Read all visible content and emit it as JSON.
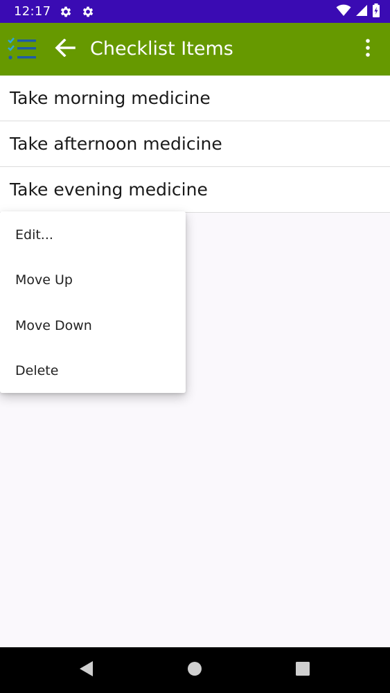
{
  "status_bar": {
    "time": "12:17",
    "icons": [
      "gear-icon",
      "gear-icon",
      "wifi-icon",
      "signal-icon",
      "battery-icon"
    ]
  },
  "app_bar": {
    "title": "Checklist Items",
    "background": "#669900",
    "icons": [
      "checklist-app-icon",
      "back-arrow-icon",
      "overflow-menu-icon"
    ]
  },
  "list": {
    "items": [
      {
        "label": "Take morning medicine"
      },
      {
        "label": "Take afternoon medicine"
      },
      {
        "label": "Take evening medicine"
      }
    ]
  },
  "context_menu": {
    "items": [
      {
        "label": "Edit..."
      },
      {
        "label": "Move Up"
      },
      {
        "label": "Move Down"
      },
      {
        "label": "Delete"
      }
    ]
  },
  "nav_bar": {
    "icons": [
      "nav-back-icon",
      "nav-home-icon",
      "nav-recents-icon"
    ]
  },
  "colors": {
    "status_bar": "#3a0bb3",
    "app_bar": "#669900",
    "app_icon_blue": "#1e5aa8",
    "app_icon_check": "#2fa4d6"
  }
}
